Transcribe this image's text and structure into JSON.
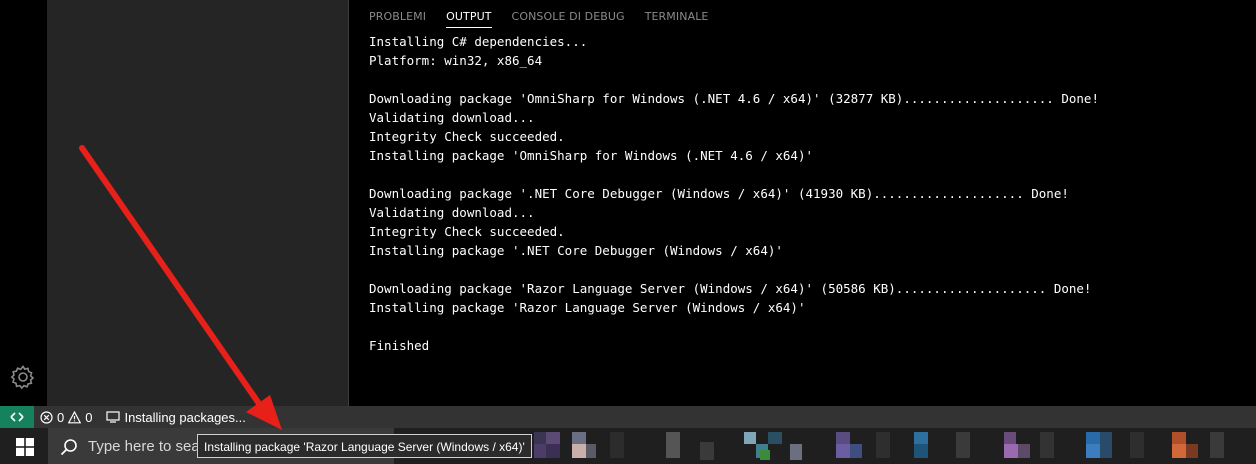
{
  "panel": {
    "tabs": [
      {
        "label": "PROBLEMI",
        "active": false
      },
      {
        "label": "OUTPUT",
        "active": true
      },
      {
        "label": "CONSOLE DI DEBUG",
        "active": false
      },
      {
        "label": "TERMINALE",
        "active": false
      }
    ],
    "output_lines": [
      "Installing C# dependencies...",
      "Platform: win32, x86_64",
      "",
      "Downloading package 'OmniSharp for Windows (.NET 4.6 / x64)' (32877 KB).................... Done!",
      "Validating download...",
      "Integrity Check succeeded.",
      "Installing package 'OmniSharp for Windows (.NET 4.6 / x64)'",
      "",
      "Downloading package '.NET Core Debugger (Windows / x64)' (41930 KB).................... Done!",
      "Validating download...",
      "Integrity Check succeeded.",
      "Installing package '.NET Core Debugger (Windows / x64)'",
      "",
      "Downloading package 'Razor Language Server (Windows / x64)' (50586 KB).................... Done!",
      "Installing package 'Razor Language Server (Windows / x64)'",
      "",
      "Finished"
    ]
  },
  "statusbar": {
    "errors": "0",
    "warnings": "0",
    "message": "Installing packages...",
    "remote_color": "#16825d",
    "background": "#333333"
  },
  "taskbar": {
    "search_placeholder": "Type here to search",
    "tooltip": "Installing package 'Razor Language Server (Windows / x64)'"
  },
  "annotation": {
    "arrow_color": "#e8201a"
  },
  "icons": {
    "settings": "gear-icon",
    "remote": "remote-icon",
    "error": "error-icon",
    "warning": "warning-icon",
    "sync": "sync-icon",
    "start": "windows-icon",
    "search": "search-icon"
  }
}
